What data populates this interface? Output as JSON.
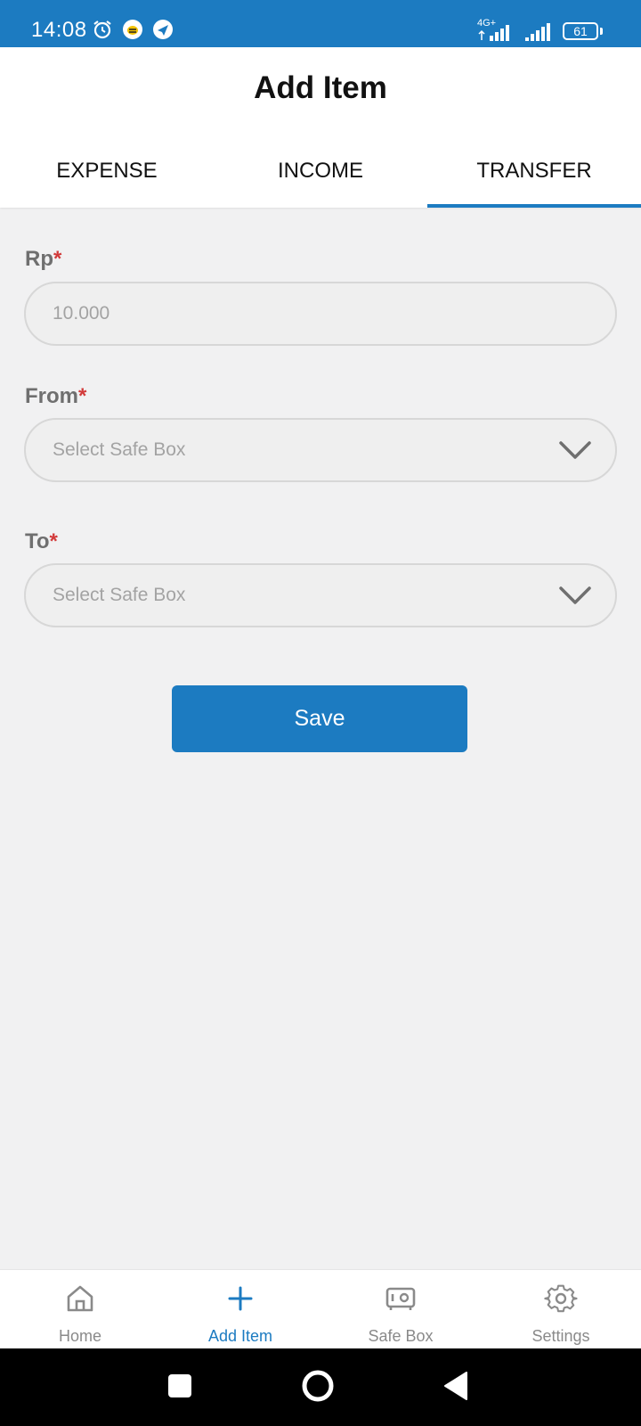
{
  "status_bar": {
    "time": "14:08",
    "network": "4G+",
    "battery": "61",
    "icons": [
      "alarm-icon",
      "bee-app-icon",
      "send-app-icon",
      "signal-icon",
      "signal-icon",
      "battery-icon"
    ]
  },
  "header": {
    "title": "Add Item",
    "tabs": [
      {
        "label": "EXPENSE",
        "active": false
      },
      {
        "label": "INCOME",
        "active": false
      },
      {
        "label": "TRANSFER",
        "active": true
      }
    ]
  },
  "form": {
    "amount": {
      "label": "Rp",
      "required_mark": "*",
      "placeholder": "10.000"
    },
    "from": {
      "label": "From",
      "required_mark": "*",
      "placeholder": "Select Safe Box"
    },
    "to": {
      "label": "To",
      "required_mark": "*",
      "placeholder": "Select Safe Box"
    },
    "save_label": "Save"
  },
  "bottom_nav": {
    "items": [
      {
        "label": "Home",
        "icon": "home-icon",
        "active": false
      },
      {
        "label": "Add Item",
        "icon": "plus-icon",
        "active": true
      },
      {
        "label": "Safe Box",
        "icon": "safe-box-icon",
        "active": false
      },
      {
        "label": "Settings",
        "icon": "gear-icon",
        "active": false
      }
    ]
  },
  "colors": {
    "primary": "#1c7bc1",
    "required": "#d23a3a",
    "background": "#f1f1f2"
  }
}
